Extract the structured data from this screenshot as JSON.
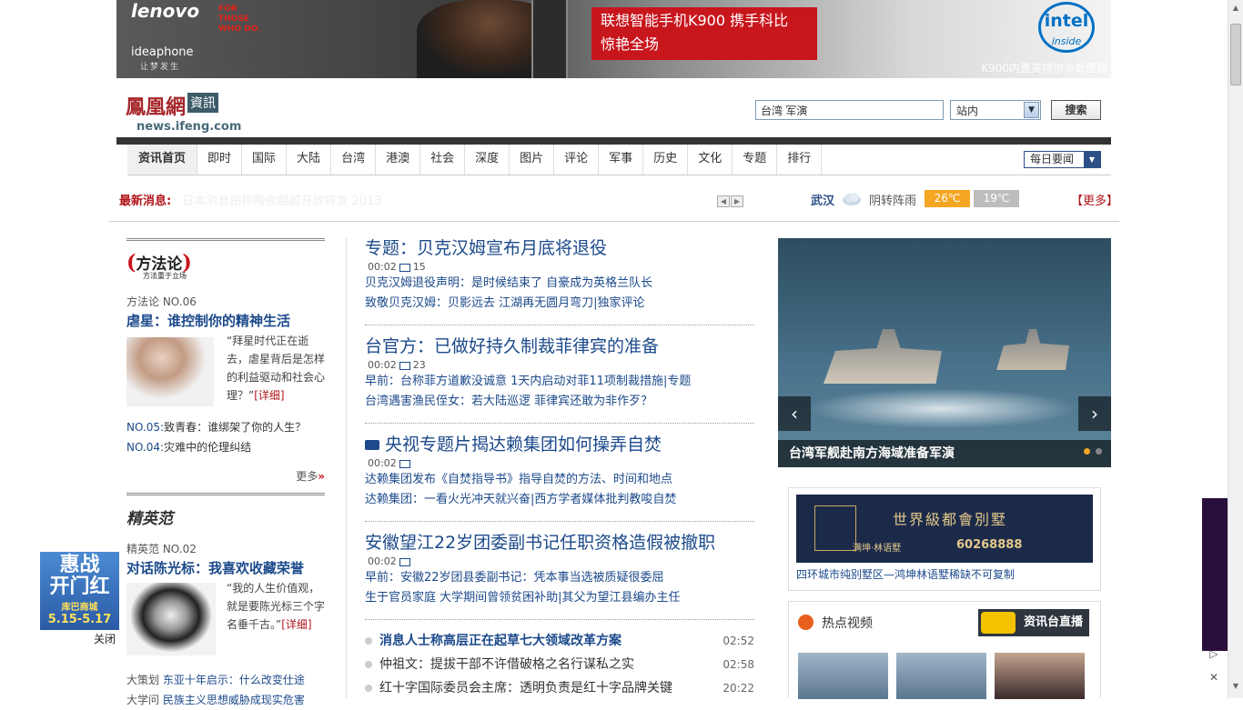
{
  "banner": {
    "brand": "lenovo",
    "tagline": [
      "FOR",
      "THOSE",
      "WHO DO."
    ],
    "sub_brand": "ideaphone",
    "sub_slogan": "让梦发生",
    "promo_line1": "联想智能手机K900 携手科比",
    "promo_line2": "惊艳全场",
    "intel": "intel",
    "intel_sub": "inside",
    "processor_note": "K900内置英特尔®处理器"
  },
  "header": {
    "logo_cn": "鳳凰網",
    "logo_box": "資訊",
    "logo_url": "news.ifeng.com",
    "search_value": "台湾 军演",
    "scope": "站内",
    "search_button": "搜索"
  },
  "nav": {
    "items": [
      "资讯首页",
      "即时",
      "国际",
      "大陆",
      "台湾",
      "港澳",
      "社会",
      "深度",
      "图片",
      "评论",
      "军事",
      "历史",
      "文化",
      "专题",
      "排行"
    ],
    "weekly": "每日要闻"
  },
  "ticker": {
    "label": "最新消息:",
    "text": "日本消息指称陶会越越开放将发 2013"
  },
  "weather": {
    "city": "武汉",
    "desc": "阴转阵雨",
    "high": "26℃",
    "low": "19℃",
    "more": "【更多】"
  },
  "left": {
    "col1": {
      "logo": "方法论",
      "logo_sub": "方法重于立场",
      "issue": "方法论 NO.06",
      "headline": "虐星：谁控制你的精神生活",
      "quote": "“拜星时代正在逝去，虐星背后是怎样的利益驱动和社会心理？”",
      "detail": "[详细]",
      "list": [
        {
          "no": "NO.05:",
          "title": "致青春：谁绑架了你的人生？"
        },
        {
          "no": "NO.04:",
          "title": "灾难中的伦理纠结"
        }
      ],
      "more": "更多",
      "more_mark": "»"
    },
    "col2": {
      "logo": "精英范",
      "issue": "精英范 NO.02",
      "headline": "对话陈光标：我喜欢收藏荣誉",
      "quote": "“我的人生价值观，就是要陈光标三个字名垂千古。”",
      "detail": "[详细]",
      "extras": [
        {
          "label": "大策划",
          "title": "东亚十年启示：什么改变仕途"
        },
        {
          "label": "大学问",
          "title": "民族主义思想威胁成现实危害"
        }
      ]
    }
  },
  "middle": {
    "stories": [
      {
        "title": "专题：贝克汉姆宣布月底将退役",
        "time": "00:02",
        "comments": "15",
        "lines": [
          "贝克汉姆退役声明：是时候结束了 自豪成为英格兰队长",
          "致敬贝克汉姆：贝影远去 江湖再无圆月弯刀|独家评论"
        ]
      },
      {
        "title": "台官方：已做好持久制裁菲律宾的准备",
        "time": "00:02",
        "comments": "23",
        "lines": [
          "早前：台称菲方道歉没诚意 1天内启动对菲11项制裁措施|专题",
          "台湾遇害渔民侄女：若大陆巡逻 菲律宾还敢为非作歹？"
        ]
      },
      {
        "title": "央视专题片揭达赖集团如何操弄自焚",
        "time": "00:02",
        "comments": "",
        "lines": [
          "达赖集团发布《自焚指导书》指导自焚的方法、时间和地点",
          "达赖集团：一看火光冲天就兴奋|西方学者媒体批判教唆自焚"
        ]
      },
      {
        "title": "安徽望江22岁团委副书记任职资格造假被撤职",
        "time": "00:02",
        "comments": "",
        "lines": [
          "早前：安徽22岁团县委副书记：凭本事当选被质疑很委屈",
          "生于官员家庭 大学期间曾领贫困补助|其父为望江县编办主任"
        ]
      }
    ],
    "hot": [
      {
        "title": "消息人士称高层正在起草七大领域改革方案",
        "time": "02:52"
      },
      {
        "title": "仲祖文：提拔干部不许借破格之名行谋私之实",
        "time": "02:58"
      },
      {
        "title": "红十字国际委员会主席：透明负责是红十字品牌关键",
        "time": "20:22"
      }
    ]
  },
  "right": {
    "slide_caption": "台湾军舰赴南方海域准备军演",
    "ad_big": "世界級都會別墅",
    "ad_small": "满坤·林语墅",
    "ad_phone": "60268888",
    "ad_text": "四环城市纯别墅区—鸿坤林语墅稀缺不可复制",
    "video_title": "热点视频",
    "live": "资讯台直播"
  },
  "float_ad": {
    "line1": "惠战",
    "line2": "开门红",
    "line3": "库巴商城",
    "line4": "5.15-5.17",
    "close": "关闭"
  }
}
